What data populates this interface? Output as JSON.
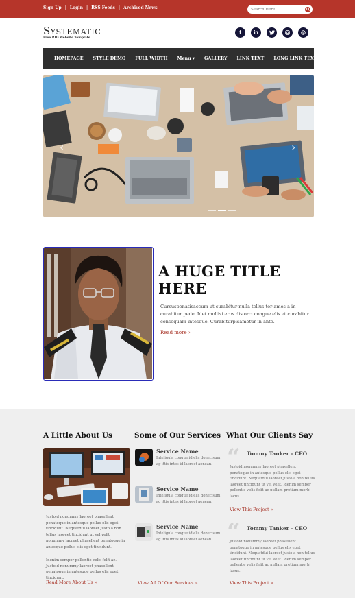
{
  "topbar": {
    "links": [
      "Sign Up",
      "Login",
      "RSS Feeds",
      "Archived News"
    ],
    "search_placeholder": "Search Here"
  },
  "header": {
    "logo": "Systematic",
    "tagline": "Free RID Website Template",
    "socials": [
      "facebook-icon",
      "linkedin-icon",
      "twitter-icon",
      "instagram-icon",
      "pinterest-icon"
    ]
  },
  "nav": {
    "items": [
      "HOMEPAGE",
      "STYLE DEMO",
      "FULL WIDTH",
      "Menu ▾",
      "GALLERY",
      "LINK TEXT",
      "LONG LINK TEXT"
    ]
  },
  "feature": {
    "title": "A HUGE TITLE HERE",
    "text": "Cursuspenatisaccum ut curabitur nulla tellus tor ames a in curabitur pede. Idet mollisi eros dis orci congue elis et curabitur consequam intesque. Curabiturpisametur in ante.",
    "link": "Read more ›"
  },
  "about": {
    "title": "A Little About Us",
    "text1": "Justoid nonummy laoreet phasellent penatoque in antesque pellus elis eget tincidunt. Nequatdui laoreet justo a non tellus laoreet tincidunt ut vel velit nonummy laoreet phasellent penatoque in antesque pellus elis eget tincidunt.",
    "text2": "Idenim semper pellentie velis felit ac. Justoid nonummy laoreet phasellent penatoque in antesque pellus elis eget tincidunt.",
    "link": "Read More About Us »"
  },
  "services": {
    "title": "Some of Our Services",
    "items": [
      {
        "name": "Service Name",
        "text": "Inteligula congue id elis donec sum ag ittis intes id laoreet aenean."
      },
      {
        "name": "Service Name",
        "text": "Inteligula congue id elis donec sum ag ittis intes id laoreet aenean."
      },
      {
        "name": "Service Name",
        "text": "Inteligula congue id elis donec sum ag ittis intes id laoreet aenean."
      }
    ],
    "link": "View All Of Our Services »"
  },
  "clients": {
    "title": "What Our Clients Say",
    "items": [
      {
        "name": "Tommy Tanker - CEO",
        "text": "Justoid nonummy laoreet phasellent penatoque in antesque pellus elis eget tincidunt. Nequatdui laoreet justo a non tellus laoreet tincidunt ut vel velit. Idenim semper pellentie velis felit ac nullam pretium morbi lacus.",
        "link": "View This Project »"
      },
      {
        "name": "Tommy Tanker - CEO",
        "text": "Justoid nonummy laoreet phasellent penatoque in antesque pellus elis eget tincidunt. Nequatdui laoreet justo a non tellus laoreet tincidunt ut vel velit. Idenim semper pellentie velis felit ac nullam pretium morbi lacus.",
        "link": "View This Project »"
      }
    ]
  },
  "colors": {
    "brand_red": "#b6352a",
    "nav_bg": "#2f2f2f",
    "social_bg": "#151538",
    "feature_border": "#2a2cb8",
    "bottom_bg": "#efefef"
  }
}
